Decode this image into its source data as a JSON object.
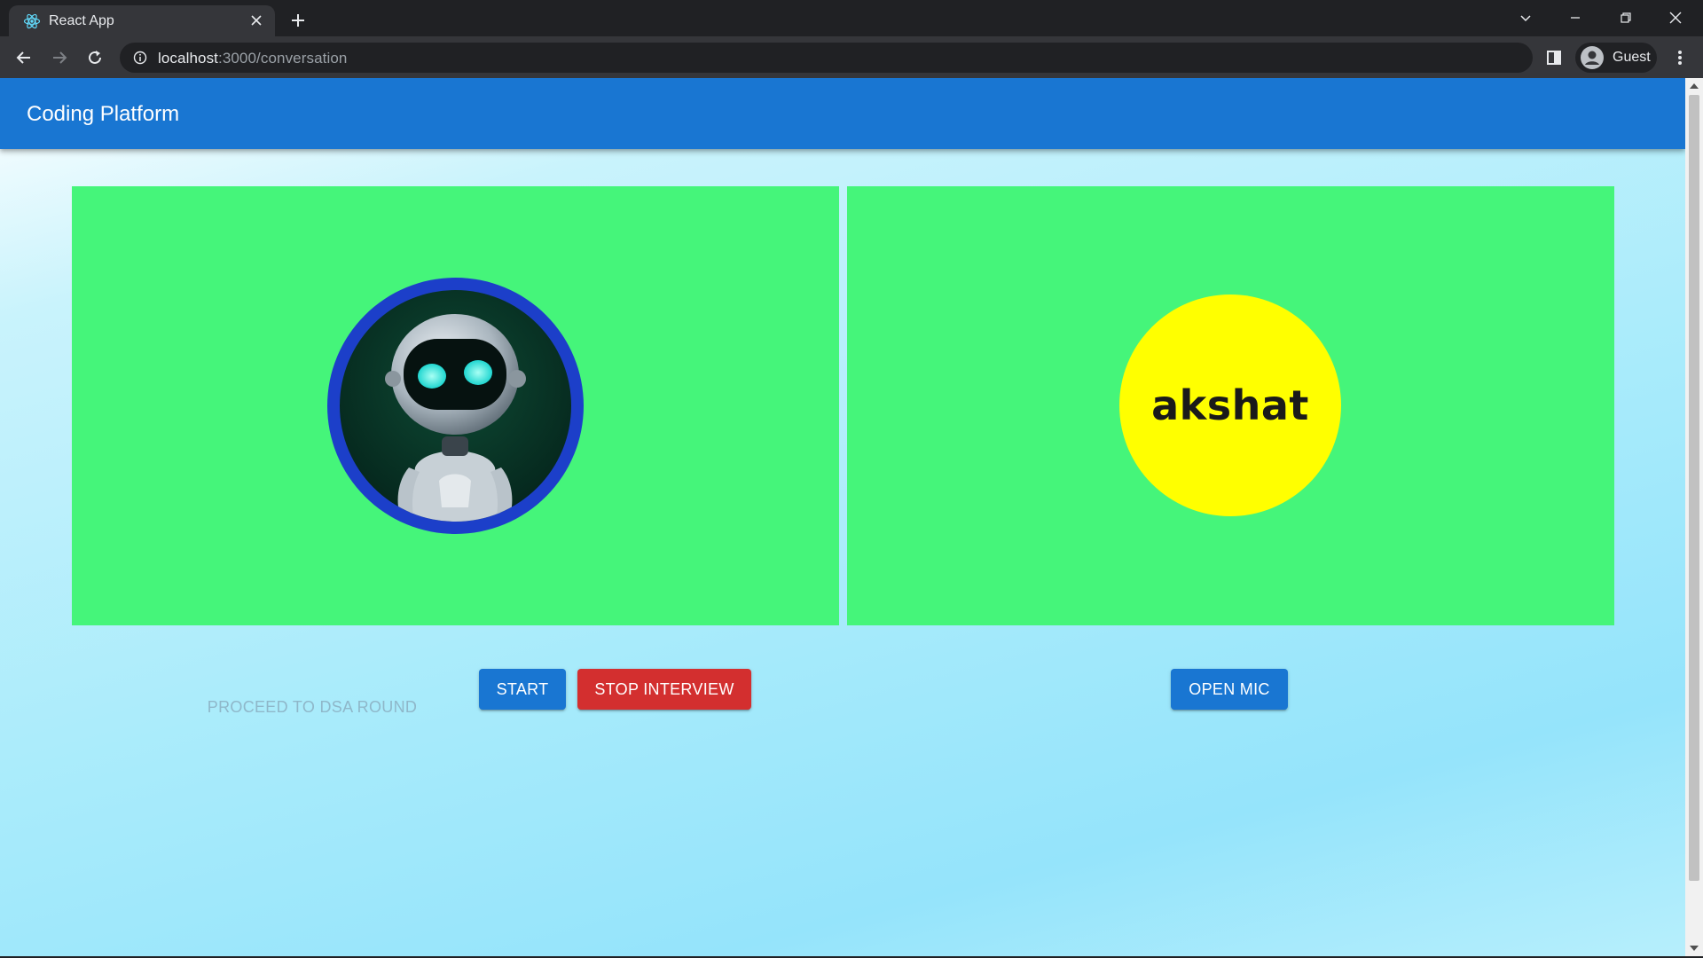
{
  "browser": {
    "tab_title": "React App",
    "url_host": "localhost",
    "url_path": ":3000/conversation",
    "profile_name": "Guest"
  },
  "app": {
    "title": "Coding Platform"
  },
  "panels": {
    "left_avatar_icon": "robot-avatar",
    "right_user_name": "akshat"
  },
  "controls": {
    "proceed_label": "PROCEED TO DSA ROUND",
    "start_label": "START",
    "stop_label": "STOP INTERVIEW",
    "mic_label": "OPEN MIC"
  },
  "colors": {
    "appbar": "#1976d2",
    "panel": "#45f57a",
    "stop": "#d32f2f",
    "user_avatar": "#ffff00",
    "robot_ring": "#1c3fc9"
  }
}
